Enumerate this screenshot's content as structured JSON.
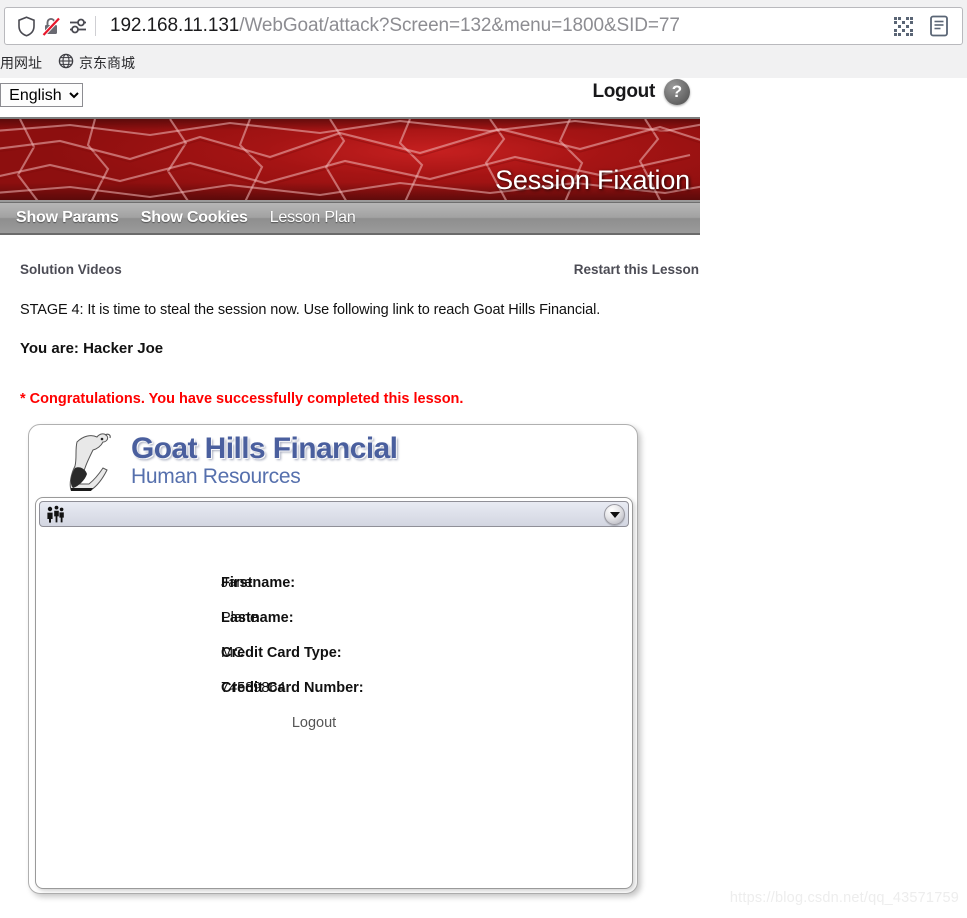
{
  "browser": {
    "url_host": "192.168.11.131",
    "url_path": "/WebGoat/attack?Screen=132&menu=1800&SID=77",
    "icons": {
      "shield": "shield-icon",
      "insecure_lock": "lock-crossed-icon",
      "permissions": "permissions-icon",
      "qr": "qr-code-icon",
      "reader": "reader-view-icon"
    },
    "bookmarks": [
      {
        "label": "用网址",
        "icon": ""
      },
      {
        "label": "京东商城",
        "icon": "globe-icon"
      }
    ]
  },
  "topbar": {
    "lang_prefix": ":",
    "language_selected": "English",
    "language_options": [
      "English"
    ],
    "logout_label": "Logout",
    "help_label": "?"
  },
  "banner": {
    "title": "Session Fixation"
  },
  "nav": {
    "items": [
      {
        "label": "Show Params",
        "bold": true
      },
      {
        "label": "Show Cookies",
        "bold": true
      },
      {
        "label": "Lesson Plan",
        "bold": false
      }
    ]
  },
  "links": {
    "solution_videos": "Solution Videos",
    "restart_lesson": "Restart this Lesson"
  },
  "lesson": {
    "stage_text": "STAGE 4: It is time to steal the session now. Use following link to reach Goat Hills Financial.",
    "you_are": "You are: Hacker Joe",
    "congratulations": "* Congratulations. You have successfully completed this lesson.",
    "congratulations_color": "#ff0000"
  },
  "ghf": {
    "title": "Goat Hills Financial",
    "subtitle": "Human Resources",
    "title_color": "#4a5f9e",
    "toolbar_icon": "people-icon",
    "dropdown_icon": "chevron-down-icon",
    "fields": [
      {
        "label": "Firstname:",
        "value": "Jane"
      },
      {
        "label": "Lastname:",
        "value": "Plane"
      },
      {
        "label": "Credit Card Type:",
        "value": "MC"
      },
      {
        "label": "Credit Card Number:",
        "value": "74589864"
      }
    ],
    "logout_label": "Logout"
  },
  "watermark": "https://blog.csdn.net/qq_43571759"
}
